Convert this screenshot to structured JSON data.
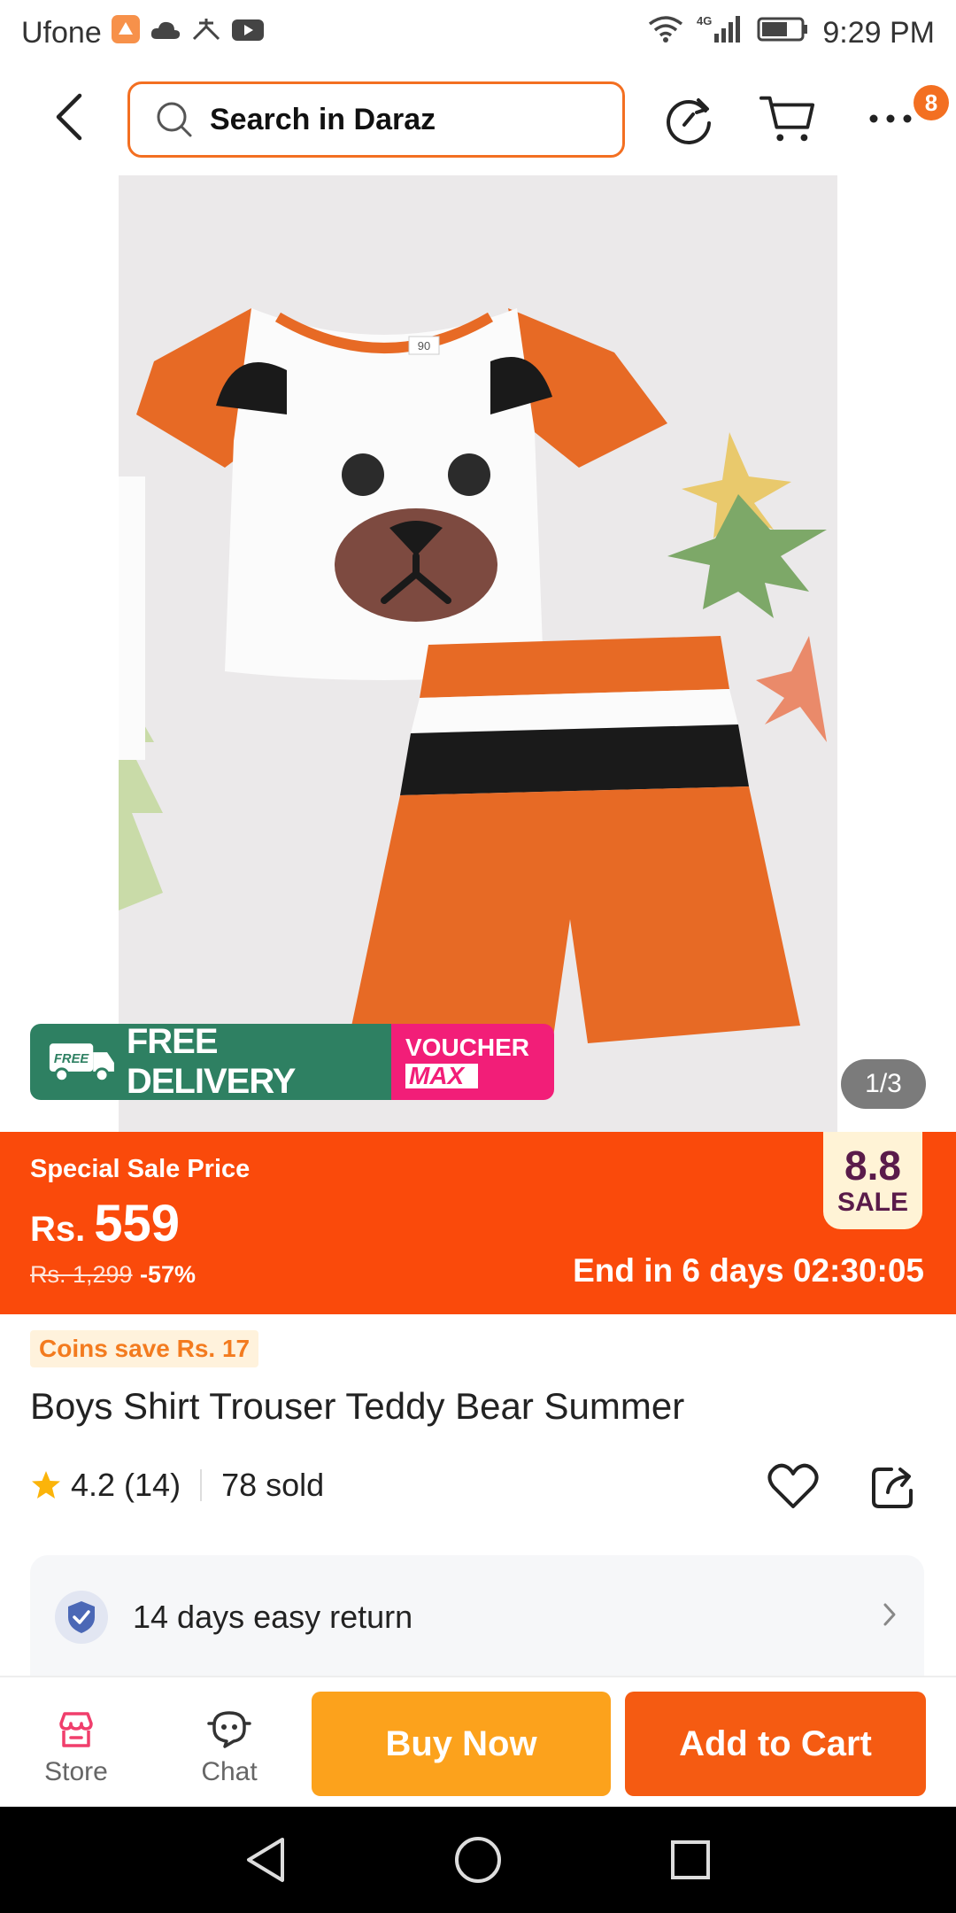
{
  "status_bar": {
    "carrier": "Ufone",
    "network": "4G",
    "time": "9:29 PM"
  },
  "header": {
    "search_placeholder": "Search in Daraz",
    "cart_badge": "8"
  },
  "product_image": {
    "counter": "1/3",
    "free_delivery": "FREE DELIVERY",
    "free_small": "FREE",
    "voucher_line1": "VOUCHER",
    "voucher_line2": "MAX",
    "shirt_size_tag": "90"
  },
  "sale": {
    "label": "Special Sale Price",
    "currency": "Rs.",
    "price": "559",
    "original_price": "Rs. 1,299",
    "discount": "-57%",
    "timer": "End in 6 days 02:30:05",
    "tag_line1": "8.8",
    "tag_line2": "SALE"
  },
  "product": {
    "coins": "Coins save Rs. 17",
    "title": "Boys Shirt Trouser Teddy Bear Summer",
    "rating": "4.2",
    "reviews": "(14)",
    "sold": "78 sold"
  },
  "return_policy": {
    "text": "14 days easy return"
  },
  "bottom_bar": {
    "store_label": "Store",
    "chat_label": "Chat",
    "buy_now": "Buy Now",
    "add_to_cart": "Add to Cart"
  },
  "colors": {
    "accent": "#f36f21",
    "sale_banner": "#fa4a0b",
    "buy_now": "#fca21c",
    "add_to_cart": "#f55b12",
    "free_delivery": "#2e8062",
    "voucher": "#f21e78"
  }
}
